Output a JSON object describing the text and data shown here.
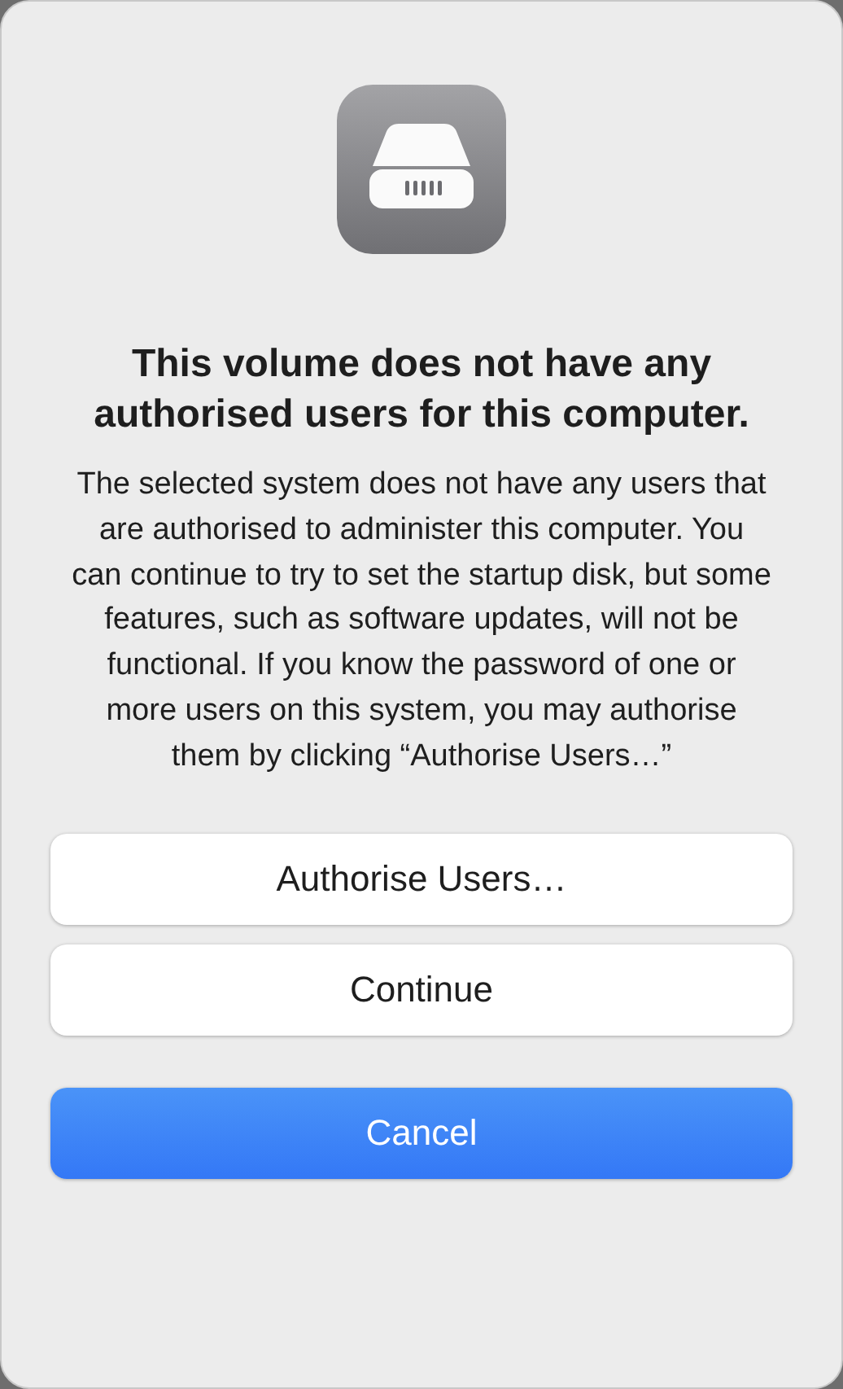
{
  "dialog": {
    "title": "This volume does not have any authorised users for this computer.",
    "message": "The selected system does not have any users that are authorised to administer this computer. You can continue to try to set the startup disk, but some features, such as software updates, will not be functional. If you know the password of one or more users on this system, you may authorise them by clicking “Authorise Users…”",
    "buttons": [
      {
        "label": "Authorise Users…",
        "kind": "secondary"
      },
      {
        "label": "Continue",
        "kind": "secondary"
      },
      {
        "label": "Cancel",
        "kind": "primary"
      }
    ]
  }
}
